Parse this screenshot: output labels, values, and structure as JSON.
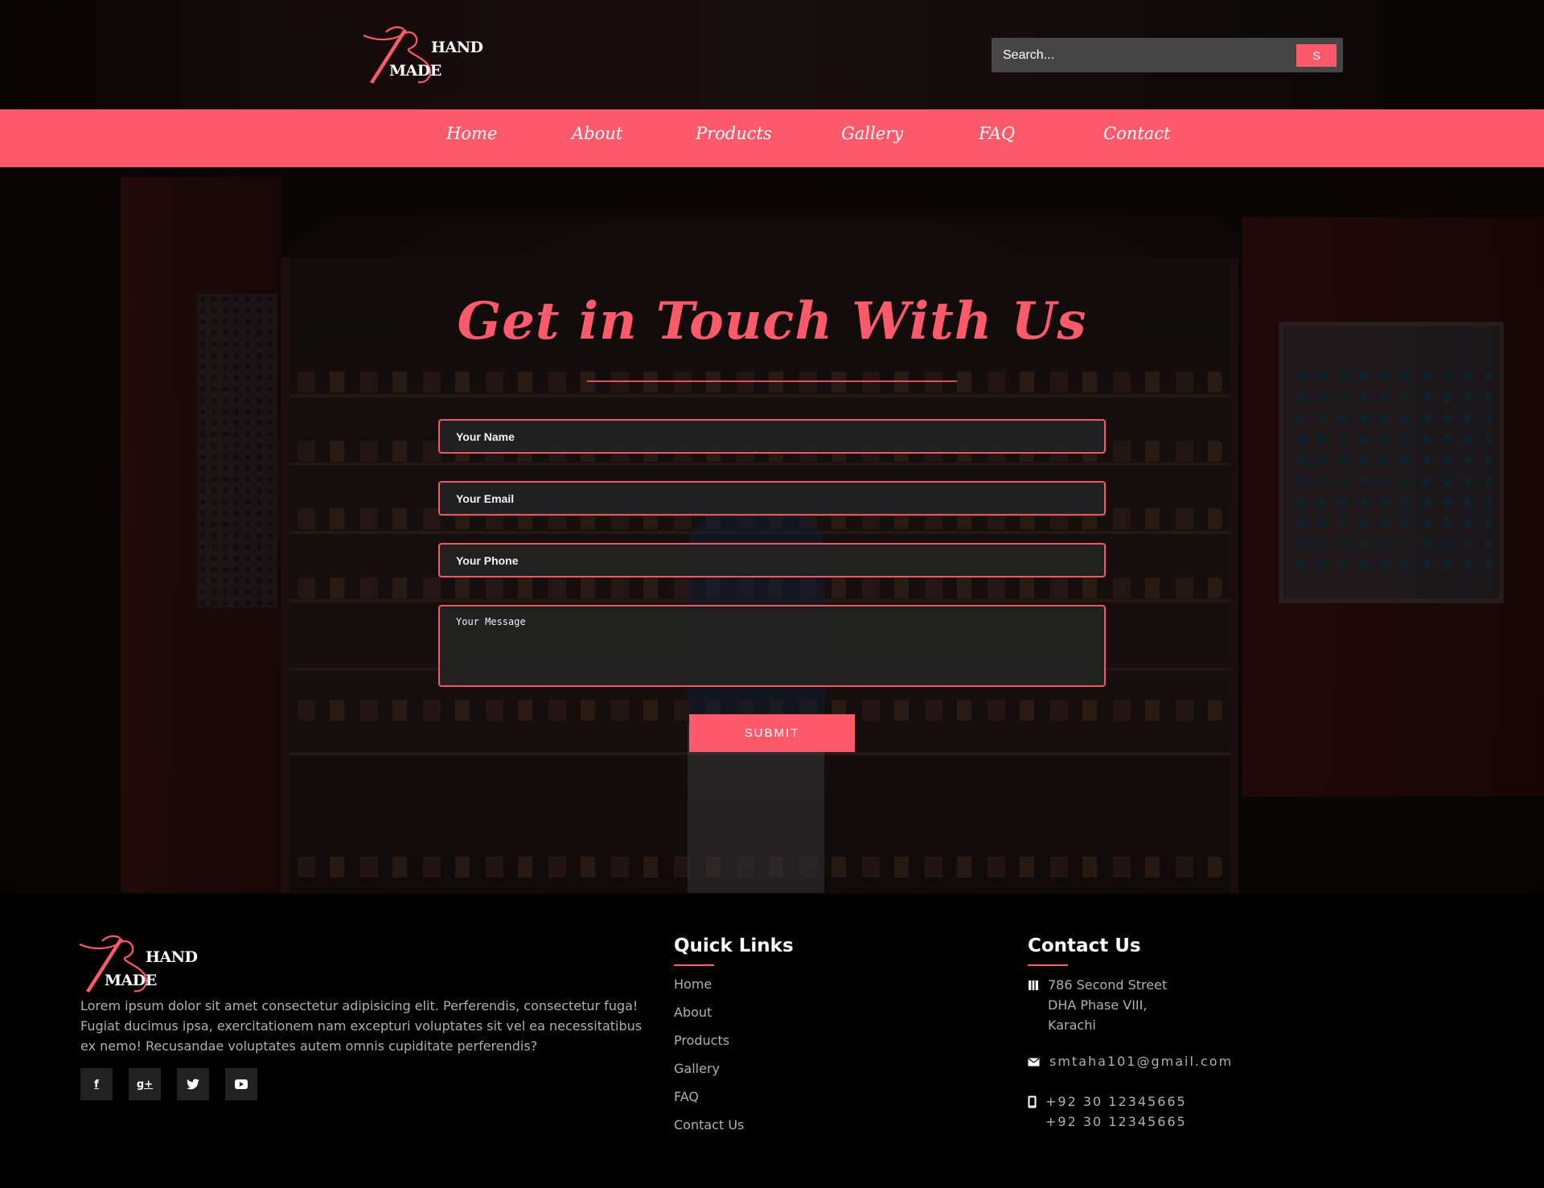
{
  "brand": {
    "logo_word_1": "HAND",
    "logo_word_2": "MADE",
    "accent_color": "#ff5a6b"
  },
  "search": {
    "placeholder": "Search...",
    "button_label": "S"
  },
  "nav": {
    "items": [
      {
        "label": "Home"
      },
      {
        "label": "About"
      },
      {
        "label": "Products"
      },
      {
        "label": "Gallery"
      },
      {
        "label": "FAQ"
      },
      {
        "label": "Contact"
      }
    ]
  },
  "contact_form": {
    "title": "Get in Touch With Us",
    "name_placeholder": "Your Name",
    "email_placeholder": "Your Email",
    "phone_placeholder": "Your Phone",
    "message_placeholder": "Your Message",
    "submit_label": "SUBMIT"
  },
  "footer": {
    "about_text": "Lorem ipsum dolor sit amet consectetur adipisicing elit. Perferendis, consectetur fuga! Fugiat ducimus ipsa, exercitationem nam excepturi voluptates sit vel ea necessitatibus ex nemo! Recusandae voluptates autem omnis cupiditate perferendis?",
    "social": [
      {
        "icon": "facebook-icon",
        "glyph": "f"
      },
      {
        "icon": "google-plus-icon",
        "glyph": "g+"
      },
      {
        "icon": "twitter-icon",
        "glyph": "🐦"
      },
      {
        "icon": "youtube-icon",
        "glyph": "▶"
      }
    ],
    "quick_links_heading": "Quick Links",
    "quick_links": [
      "Home",
      "About",
      "Products",
      "Gallery",
      "FAQ",
      "Contact Us"
    ],
    "contact_heading": "Contact Us",
    "address_line_1": "786 Second Street",
    "address_line_2": "DHA Phase VIII,",
    "address_line_3": "Karachi",
    "email": "smtaha101@gmail.com",
    "phone_1": "+92 30 12345665",
    "phone_2": "+92 30 12345665",
    "icons": {
      "address": "map-icon",
      "email": "envelope-icon",
      "phone": "mobile-icon"
    }
  }
}
